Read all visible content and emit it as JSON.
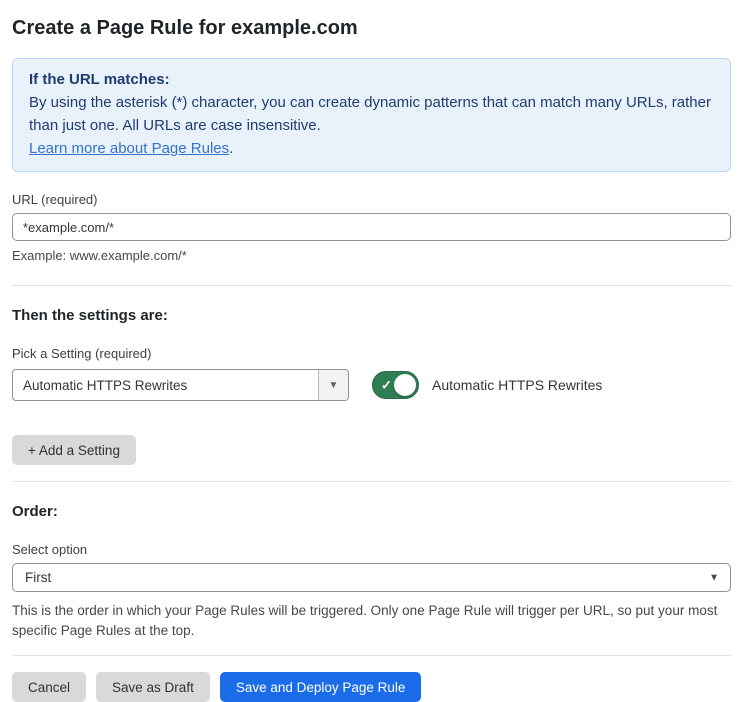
{
  "page": {
    "title": "Create a Page Rule for example.com"
  },
  "info_box": {
    "title": "If the URL matches:",
    "body": "By using the asterisk (*) character, you can create dynamic patterns that can match many URLs, rather than just one. All URLs are case insensitive.",
    "link_text": "Learn more about Page Rules",
    "link_suffix": "."
  },
  "url_field": {
    "label": "URL (required)",
    "value": "*example.com/*",
    "hint": "Example: www.example.com/*"
  },
  "settings_section": {
    "heading": "Then the settings are:",
    "pick_label": "Pick a Setting (required)",
    "selected_setting": "Automatic HTTPS Rewrites",
    "toggle_state": "on",
    "toggle_label": "Automatic HTTPS Rewrites",
    "add_button_label": "+ Add a Setting"
  },
  "order_section": {
    "heading": "Order:",
    "select_label": "Select option",
    "selected_option": "First",
    "help_text": "This is the order in which your Page Rules will be triggered. Only one Page Rule will trigger per URL, so put your most specific Page Rules at the top."
  },
  "footer": {
    "cancel_label": "Cancel",
    "save_draft_label": "Save as Draft",
    "save_deploy_label": "Save and Deploy Page Rule"
  },
  "icons": {
    "dropdown_arrow": "▼",
    "checkmark": "✓"
  },
  "colors": {
    "info_bg": "#e9f2fb",
    "info_border": "#b9d7f3",
    "info_text": "#1e3c70",
    "link_blue": "#3672cc",
    "toggle_green": "#2f7d52",
    "primary_button_blue": "#1a6ce8",
    "gray_button": "#d9d9d9"
  }
}
